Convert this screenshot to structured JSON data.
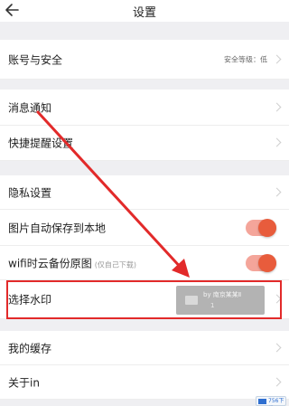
{
  "header": {
    "title": "设置"
  },
  "account": {
    "label": "账号与安全",
    "security_level": "安全等级：低"
  },
  "notifications": {
    "label": "消息通知"
  },
  "quick_reminder": {
    "label": "快捷提醒设置"
  },
  "privacy": {
    "label": "隐私设置"
  },
  "auto_save": {
    "label": "图片自动保存到本地",
    "enabled": true
  },
  "wifi_backup": {
    "label": "wifi时云备份原图",
    "note": "(仅自己下载)",
    "enabled": true
  },
  "watermark": {
    "label": "选择水印",
    "preview_line1": "by 南京某某Ⅱ",
    "preview_line2": "1"
  },
  "cache": {
    "label": "我的缓存"
  },
  "about": {
    "label": "关于in"
  },
  "corner_badge": {
    "text": "756下载网"
  },
  "colors": {
    "accent": "#e85c3c",
    "annotation": "#e22a2a"
  }
}
